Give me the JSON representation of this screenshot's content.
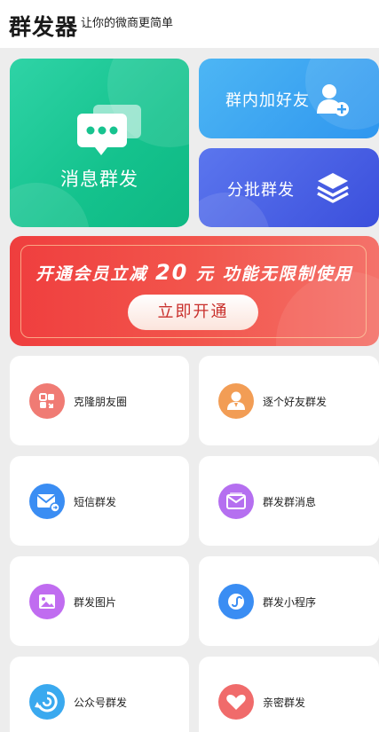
{
  "header": {
    "logo": "群发器",
    "slogan": "让你的微商更简单"
  },
  "top_cards": {
    "message_broadcast": "消息群发",
    "group_add_friends": "群内加好友",
    "batch_broadcast": "分批群发"
  },
  "banner": {
    "text_before": "开通会员立减 ",
    "amount": "20",
    "text_after": " 元  功能无限制使用",
    "button": "立即开通"
  },
  "tiles": [
    {
      "label": "克隆朋友圈",
      "icon": "clone-icon",
      "color": "#f07b74"
    },
    {
      "label": "逐个好友群发",
      "icon": "person-icon",
      "color": "#f29d55"
    },
    {
      "label": "短信群发",
      "icon": "sms-icon",
      "color": "#3a8df3"
    },
    {
      "label": "群发群消息",
      "icon": "envelope-icon",
      "color": "#b56ff0"
    },
    {
      "label": "群发图片",
      "icon": "image-icon",
      "color": "#c06cf0"
    },
    {
      "label": "群发小程序",
      "icon": "mini-program-icon",
      "color": "#3a8df3"
    },
    {
      "label": "公众号群发",
      "icon": "official-account-icon",
      "color": "#3aa9ef"
    },
    {
      "label": "亲密群发",
      "icon": "heart-icon",
      "color": "#f06b6b"
    }
  ]
}
